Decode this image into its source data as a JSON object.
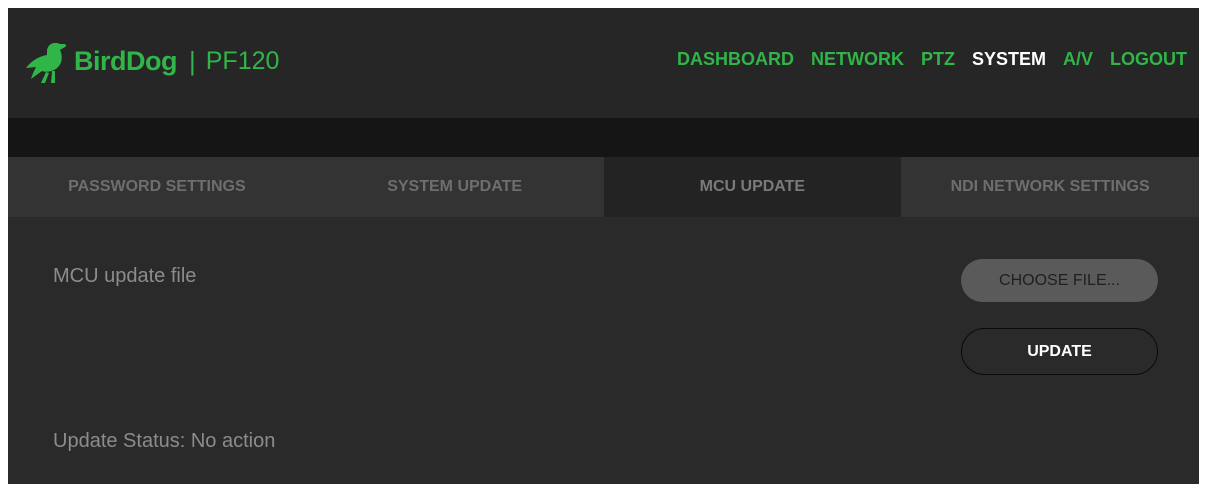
{
  "header": {
    "brand": "BirdDog",
    "separator": "|",
    "model": "PF120",
    "logo_icon": "bird-icon"
  },
  "nav": {
    "items": [
      {
        "label": "DASHBOARD",
        "active": false
      },
      {
        "label": "NETWORK",
        "active": false
      },
      {
        "label": "PTZ",
        "active": false
      },
      {
        "label": "SYSTEM",
        "active": true
      },
      {
        "label": "A/V",
        "active": false
      },
      {
        "label": "LOGOUT",
        "active": false
      }
    ]
  },
  "tabs": {
    "items": [
      {
        "label": "PASSWORD SETTINGS",
        "active": false
      },
      {
        "label": "SYSTEM UPDATE",
        "active": false
      },
      {
        "label": "MCU UPDATE",
        "active": true
      },
      {
        "label": "NDI NETWORK SETTINGS",
        "active": false
      }
    ]
  },
  "mcu": {
    "file_label": "MCU update file",
    "choose_label": "CHOOSE FILE...",
    "update_label": "UPDATE",
    "status_text": "Update Status: No action"
  },
  "colors": {
    "accent": "#2fb548",
    "active_nav": "#ffffff",
    "background": "#2a2a2a",
    "header": "#262626"
  }
}
